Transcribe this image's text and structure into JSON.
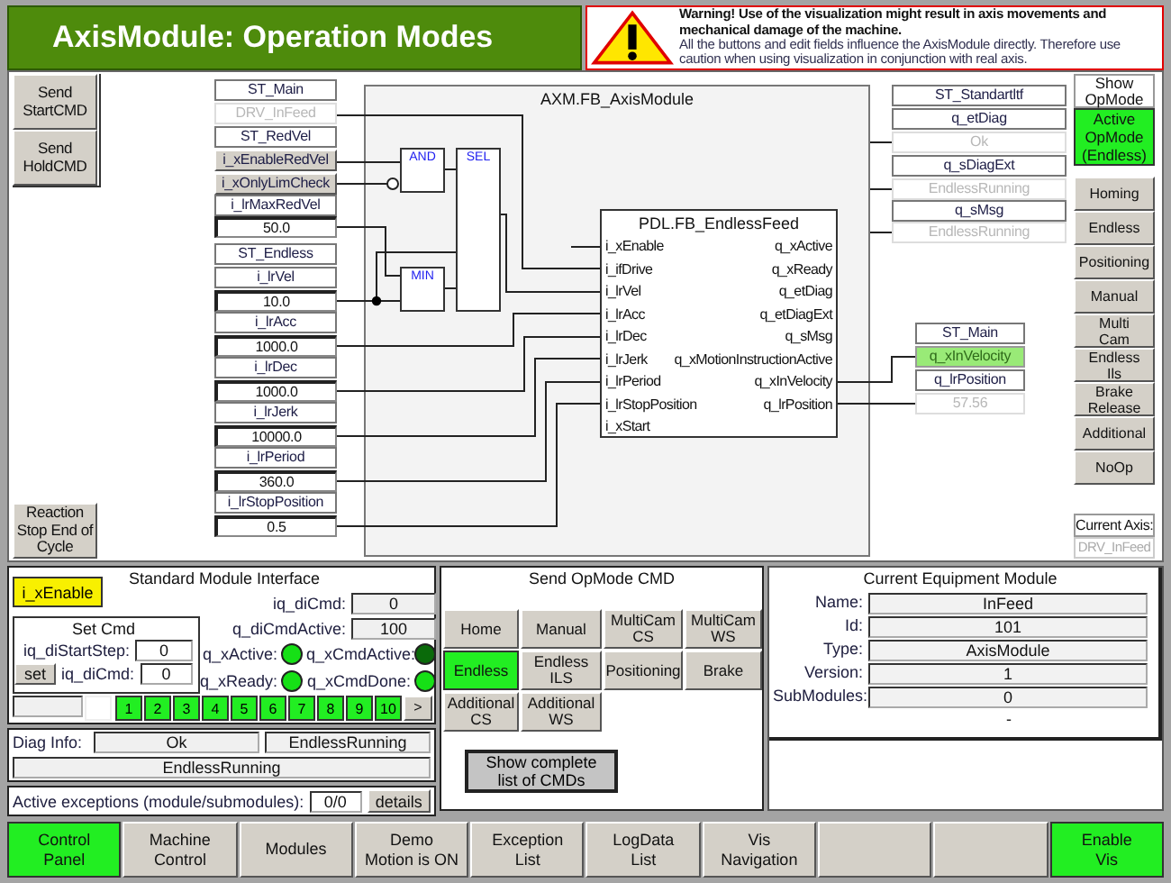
{
  "title": "AxisModule: Operation Modes",
  "warning": {
    "heading": "Warning! Use of the visualization might result in axis movements and mechanical damage of the machine.",
    "text": "All the buttons and edit fields influence the AxisModule directly. Therefore use caution when using visualization in conjunction with real axis."
  },
  "left_buttons": [
    {
      "label": "Send\nStartCMD"
    },
    {
      "label": "Send\nHoldCMD"
    }
  ],
  "reaction_button": {
    "label": "Reaction\nStop End of\nCycle"
  },
  "diagram": {
    "module_title": "AXM.FB_AxisModule",
    "inputs": [
      {
        "text": "ST_Main",
        "kind": "label"
      },
      {
        "text": "DRV_InFeed",
        "kind": "readonly"
      },
      {
        "text": "ST_RedVel",
        "kind": "label"
      },
      {
        "text": "i_xEnableRedVel",
        "kind": "toggle"
      },
      {
        "text": "i_xOnlyLimCheck",
        "kind": "toggle"
      },
      {
        "text": "i_lrMaxRedVel",
        "kind": "label"
      },
      {
        "text": "50.0",
        "kind": "value"
      },
      {
        "text": "ST_Endless",
        "kind": "label"
      },
      {
        "text": "i_lrVel",
        "kind": "label"
      },
      {
        "text": "10.0",
        "kind": "value"
      },
      {
        "text": "i_lrAcc",
        "kind": "label"
      },
      {
        "text": "1000.0",
        "kind": "value"
      },
      {
        "text": "i_lrDec",
        "kind": "label"
      },
      {
        "text": "1000.0",
        "kind": "value"
      },
      {
        "text": "i_lrJerk",
        "kind": "label"
      },
      {
        "text": "10000.0",
        "kind": "value"
      },
      {
        "text": "i_lrPeriod",
        "kind": "label"
      },
      {
        "text": "360.0",
        "kind": "value"
      },
      {
        "text": "i_lrStopPosition",
        "kind": "label"
      },
      {
        "text": "0.5",
        "kind": "value"
      }
    ],
    "gates": [
      {
        "label": "AND"
      },
      {
        "label": "SEL"
      },
      {
        "label": "MIN"
      }
    ],
    "function_block": {
      "title": "PDL.FB_EndlessFeed",
      "inputs": [
        "i_xEnable",
        "i_ifDrive",
        "i_lrVel",
        "i_lrAcc",
        "i_lrDec",
        "i_lrJerk",
        "i_lrPeriod",
        "i_lrStopPosition",
        "i_xStart"
      ],
      "outputs": [
        "q_xActive",
        "q_xReady",
        "q_etDiag",
        "q_etDiagExt",
        "q_sMsg",
        "q_xMotionInstructionActive",
        "q_xInVelocity",
        "q_lrPosition"
      ]
    },
    "diag_outputs": [
      {
        "text": "ST_Standartltf",
        "kind": "label"
      },
      {
        "text": "q_etDiag",
        "kind": "label"
      },
      {
        "text": "Ok",
        "kind": "readonly"
      },
      {
        "text": "q_sDiagExt",
        "kind": "label"
      },
      {
        "text": "EndlessRunning",
        "kind": "readonly"
      },
      {
        "text": "q_sMsg",
        "kind": "label"
      },
      {
        "text": "EndlessRunning",
        "kind": "readonly"
      }
    ],
    "main_outputs": [
      {
        "text": "ST_Main",
        "kind": "label"
      },
      {
        "text": "q_xInVelocity",
        "kind": "lamp",
        "on": true
      },
      {
        "text": "q_lrPosition",
        "kind": "label"
      },
      {
        "text": "57.56",
        "kind": "readonly"
      }
    ]
  },
  "opmode": {
    "heading": "Show\nOpMode",
    "active": "Active\nOpMode\n(Endless)",
    "buttons": [
      {
        "label": "Homing"
      },
      {
        "label": "Endless"
      },
      {
        "label": "Positioning"
      },
      {
        "label": "Manual"
      },
      {
        "label": "Multi\nCam"
      },
      {
        "label": "Endless\nIls"
      },
      {
        "label": "Brake\nRelease"
      },
      {
        "label": "Additional"
      },
      {
        "label": "NoOp"
      }
    ],
    "axis_label": "Current Axis:",
    "axis_value": "DRV_InFeed"
  },
  "standard_interface": {
    "title": "Standard Module Interface",
    "enable": {
      "label": "i_xEnable",
      "on": true
    },
    "fields": [
      {
        "label": "iq_diCmd:",
        "value": "0"
      },
      {
        "label": "q_diCmdActive:",
        "value": "100"
      }
    ],
    "set_cmd": {
      "title": "Set Cmd",
      "fields": [
        {
          "label": "iq_diStartStep:",
          "value": "0"
        },
        {
          "label": "iq_diCmd:",
          "value": "0"
        }
      ],
      "button": "set"
    },
    "leds": [
      {
        "label": "q_xActive:",
        "on": true
      },
      {
        "label": "q_xCmdActive:",
        "on": false
      },
      {
        "label": "q_xReady:",
        "on": true
      },
      {
        "label": "q_xCmdDone:",
        "on": true
      }
    ],
    "steps": [
      {
        "label": "1",
        "on": true
      },
      {
        "label": "2",
        "on": true
      },
      {
        "label": "3",
        "on": true
      },
      {
        "label": "4",
        "on": true
      },
      {
        "label": "5",
        "on": true
      },
      {
        "label": "6",
        "on": true
      },
      {
        "label": "7",
        "on": true
      },
      {
        "label": "8",
        "on": true
      },
      {
        "label": "9",
        "on": true
      },
      {
        "label": "10",
        "on": true
      }
    ],
    "next": ">",
    "diag_label": "Diag Info:",
    "diag": [
      "Ok",
      "EndlessRunning"
    ],
    "diag_message": "EndlessRunning",
    "exceptions_label": "Active exceptions (module/submodules):",
    "exceptions_value": "0/0",
    "details": "details"
  },
  "send_opmode": {
    "title": "Send OpMode CMD",
    "buttons": [
      {
        "label": "Home",
        "selected": false
      },
      {
        "label": "Manual",
        "selected": false
      },
      {
        "label": "MultiCam\nCS",
        "selected": false
      },
      {
        "label": "MultiCam\nWS",
        "selected": false
      },
      {
        "label": "Endless",
        "selected": true
      },
      {
        "label": "Endless\nILS",
        "selected": false
      },
      {
        "label": "Positioning",
        "selected": false
      },
      {
        "label": "Brake",
        "selected": false
      },
      {
        "label": "Additional\nCS",
        "selected": false
      },
      {
        "label": "Additional\nWS",
        "selected": false
      }
    ],
    "list_button": "Show complete\nlist of CMDs"
  },
  "equipment": {
    "title": "Current Equipment Module",
    "rows": [
      {
        "label": "Name:",
        "value": "InFeed"
      },
      {
        "label": "Id:",
        "value": "101"
      },
      {
        "label": "Type:",
        "value": "AxisModule"
      },
      {
        "label": "Version:",
        "value": "1"
      },
      {
        "label": "SubModules:",
        "value": "0"
      }
    ],
    "footer": "-"
  },
  "bottom_bar": [
    {
      "label": "Control\nPanel",
      "on": true
    },
    {
      "label": "Machine\nControl",
      "on": false
    },
    {
      "label": "Modules",
      "on": false
    },
    {
      "label": "Demo\nMotion is ON",
      "on": false
    },
    {
      "label": "Exception\nList",
      "on": false
    },
    {
      "label": "LogData\nList",
      "on": false
    },
    {
      "label": "Vis\nNavigation",
      "on": false
    },
    {
      "on": false
    },
    {
      "on": false
    },
    {
      "label": "Enable\nVis",
      "on": true
    }
  ]
}
